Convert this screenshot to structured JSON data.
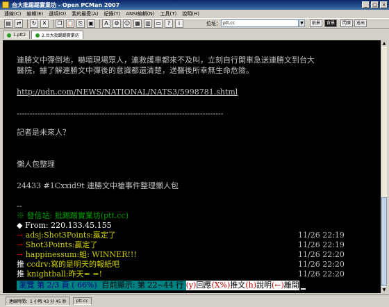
{
  "window": {
    "title": "台大批踢踢實業坊 - Open PCMan 2007",
    "controls": [
      "_",
      "□",
      "×"
    ]
  },
  "menu": [
    "連線(C)",
    "編輯(E)",
    "選項(O)",
    "我的最愛(A)",
    "紀錄(Y)",
    "ANSI編輯(N)",
    "工具(T)",
    "說明(H)"
  ],
  "toolbar": {
    "address_label": "位址：",
    "address_value": "ptt.cc",
    "buttons": [
      "前景",
      "背景",
      "閃爍",
      "送出"
    ]
  },
  "tabs": [
    {
      "label": "1.ptt2"
    },
    {
      "label": "2.台大批踢踢實業坊"
    }
  ],
  "terminal": {
    "paragraph_1": "連勝文中彈倒地，嚇壞現場眾人，連救護車都來不及叫，立刻自行開車急送連勝文到台大",
    "paragraph_2": "醫院，據了解連勝文中彈後的意識都還清楚，送醫後所幸無生命危險。",
    "link": "http://udn.com/NEWS/NATIONAL/NATS3/5998781.shtml",
    "separator": "--------------------------------------------------------------------------------",
    "question": "記者是未來人？",
    "lazy_pack": "懶人包整理",
    "article_ref": "24433 #1Cxxid9t 連勝文中槍事件整理懶人包",
    "sig_dash": "--",
    "site_line": "※ 發信站: 批踢踢實業坊(ptt.cc)",
    "from_line": "◆ From: 220.133.45.155",
    "pushes": [
      {
        "tag": "→",
        "user": "adsj",
        "text": ":Shot3Points:贏定了",
        "time": "11/26 22:19"
      },
      {
        "tag": "→",
        "user": "Shot3Points",
        "text": ":贏定了",
        "time": "11/26 22:19"
      },
      {
        "tag": "→",
        "user": "happinessum",
        "text": ":蛆: WINNER!!!",
        "time": "11/26 22:20"
      },
      {
        "tag": "推",
        "user": "ccdrv",
        "text": ":寫的是明天的報紙吧",
        "time": "11/26 22:20"
      },
      {
        "tag": "推",
        "user": "knightball",
        "text": ":昨天= =!",
        "time": "11/26 22:20"
      }
    ],
    "status": {
      "browse": " 瀏覽 第 2/3 頁 ( 66%) ",
      "showing": " 目前顯示: 第 22~44 行 ",
      "keys": [
        "(y)",
        "回應",
        "(X%)",
        "推文",
        "(h)",
        "說明",
        "(←)",
        "離開"
      ]
    }
  },
  "statusbar": {
    "connect_time": "連線時間：1 小時 43 分 45 秒",
    "host": "ptt.cc"
  }
}
